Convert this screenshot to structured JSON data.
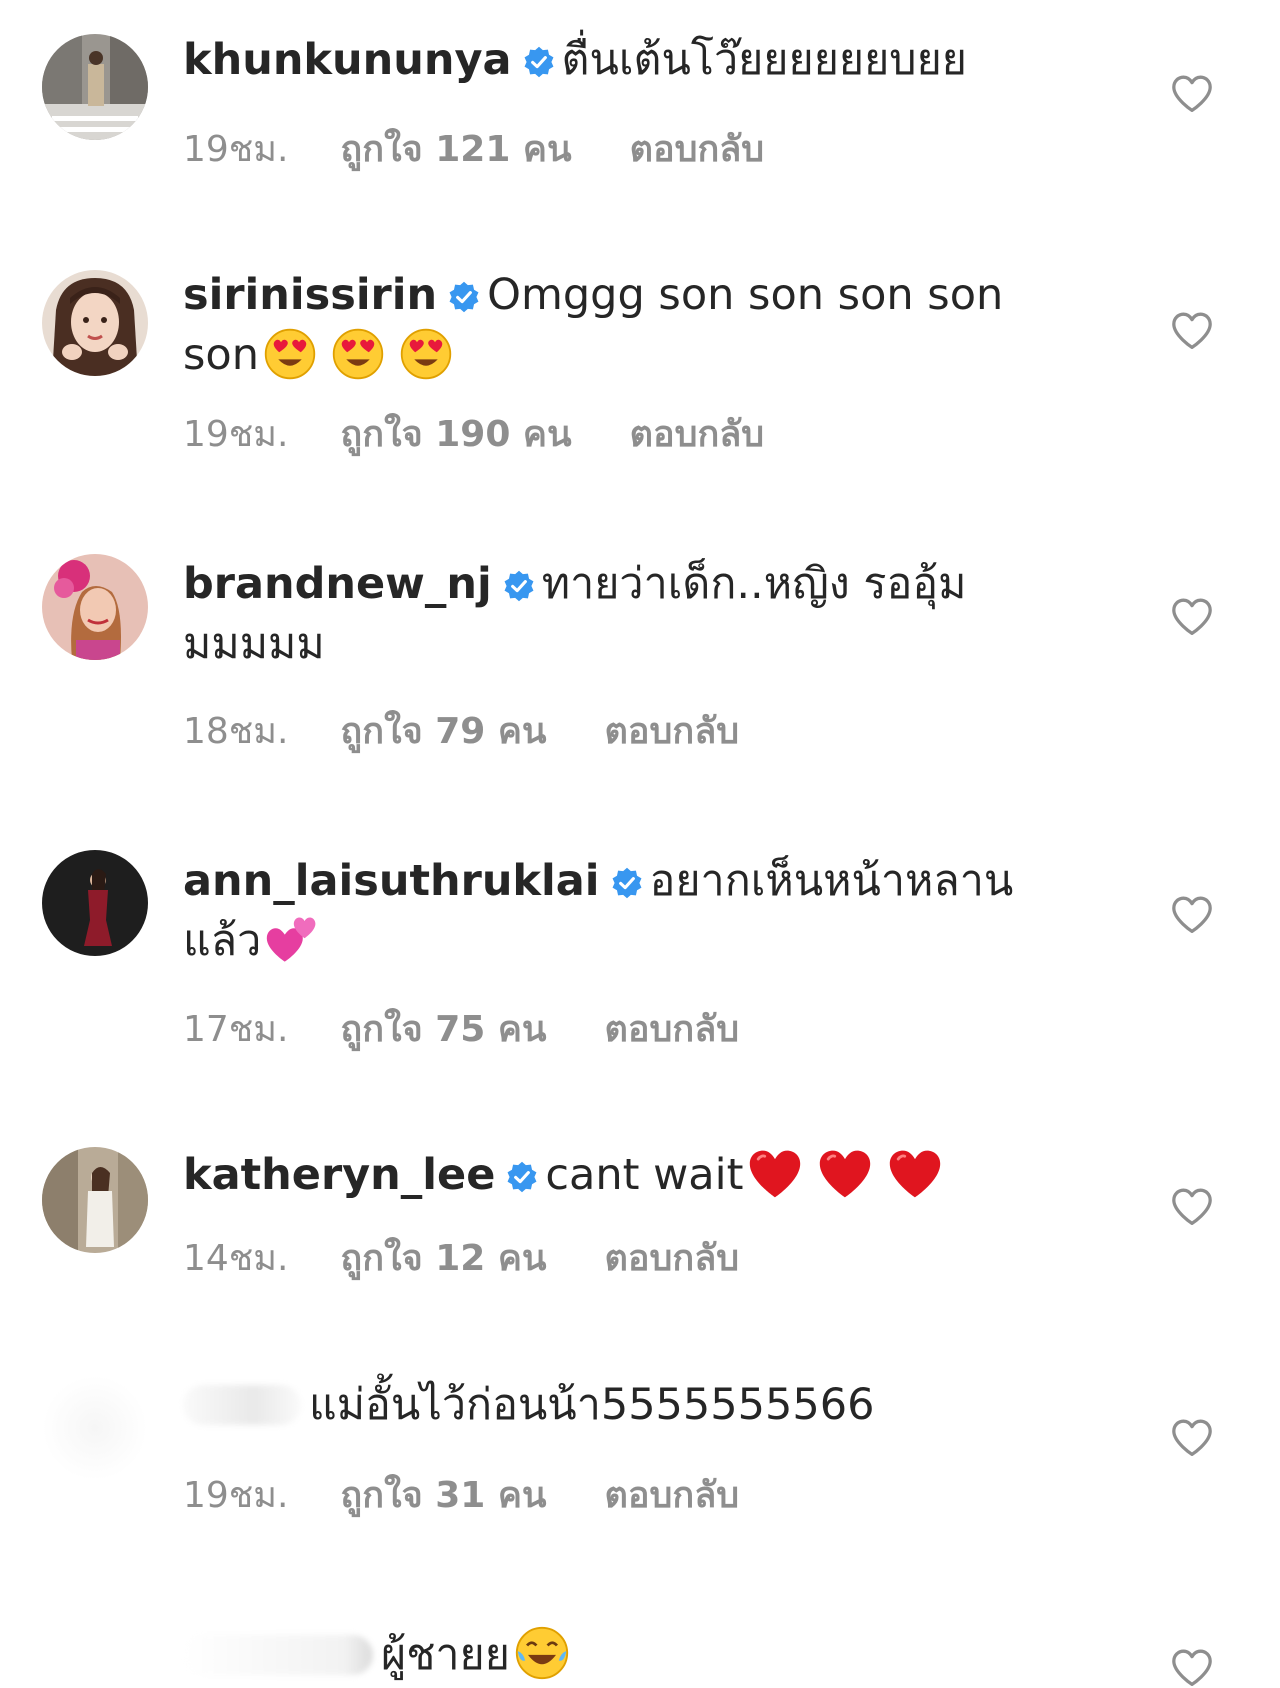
{
  "comments": [
    {
      "username": "khunkununya",
      "verified": true,
      "text": "ตื่นเต้นโว๊ยยยยยยบยย",
      "emojis": [],
      "time": "19ชม.",
      "likes": "ถูกใจ 121 คน",
      "reply": "ตอบกลับ"
    },
    {
      "username": "sirinissirin",
      "verified": true,
      "text": "Omggg son son son son son",
      "emojis": [
        "heart-eyes",
        "heart-eyes",
        "heart-eyes"
      ],
      "time": "19ชม.",
      "likes": "ถูกใจ 190 คน",
      "reply": "ตอบกลับ"
    },
    {
      "username": "brandnew_nj",
      "verified": true,
      "text": "ทายว่าเด็ก..หญิง รออุ้มมมมมม",
      "emojis": [],
      "time": "18ชม.",
      "likes": "ถูกใจ 79 คน",
      "reply": "ตอบกลับ"
    },
    {
      "username": "ann_laisuthruklai",
      "verified": true,
      "text": "อยากเห็นหน้าหลานแล้ว",
      "emojis": [
        "two-hearts"
      ],
      "time": "17ชม.",
      "likes": "ถูกใจ 75 คน",
      "reply": "ตอบกลับ"
    },
    {
      "username": "katheryn_lee",
      "verified": true,
      "text": "cant wait",
      "emojis": [
        "red-heart",
        "red-heart",
        "red-heart"
      ],
      "time": "14ชม.",
      "likes": "ถูกใจ 12 คน",
      "reply": "ตอบกลับ"
    },
    {
      "username": "",
      "verified": false,
      "text": "แม่อั้นไว้ก่อนน้า5555555566",
      "emojis": [],
      "time": "19ชม.",
      "likes": "ถูกใจ 31 คน",
      "reply": "ตอบกลับ"
    },
    {
      "username": "",
      "verified": false,
      "text": "ผู้ชายย",
      "emojis": [
        "tears-of-joy"
      ],
      "time": "",
      "likes": "",
      "reply": ""
    }
  ],
  "colors": {
    "text": "#262626",
    "meta": "#8e8e8e",
    "verified": "#3897f0",
    "heart_outline": "#8e8e8e"
  },
  "icons": {
    "verified": "verified-badge-icon",
    "like": "heart-outline-icon"
  }
}
